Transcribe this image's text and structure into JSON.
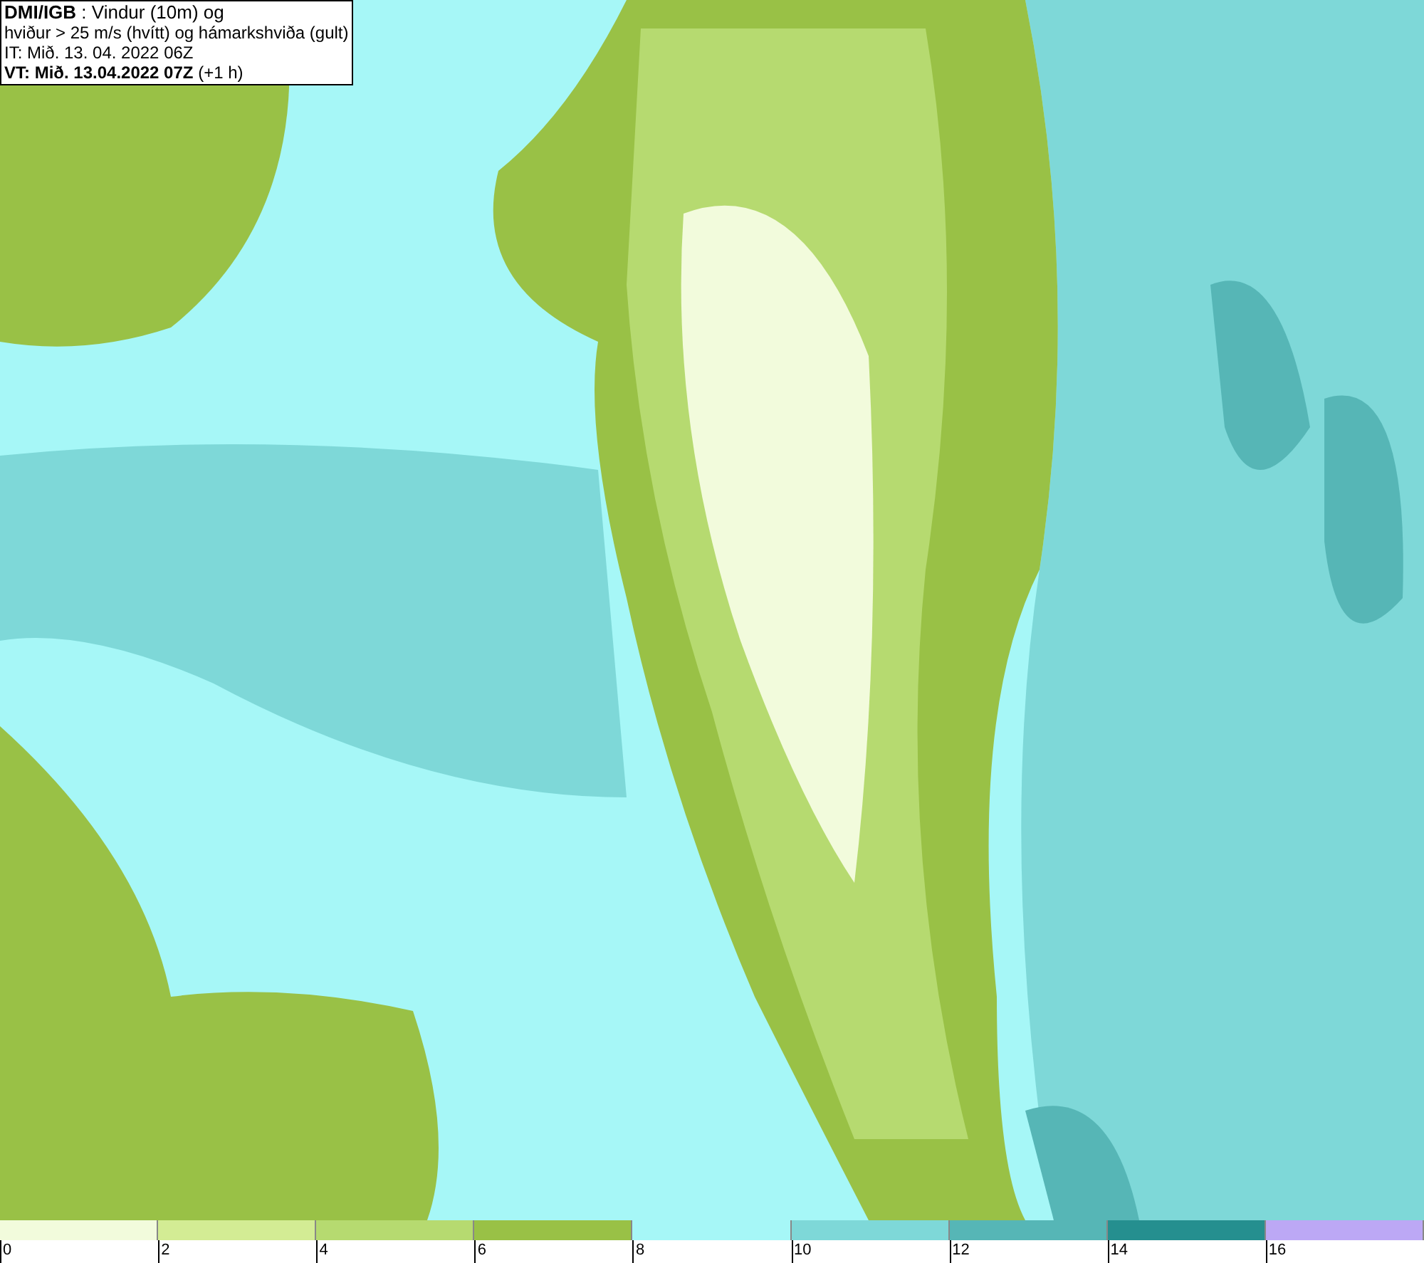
{
  "info_box": {
    "lines": [
      "**DMI/IGB** : Vindur (10m) og",
      "hviður > 25 m/s (hvítt) og hámarkshviða (gult)",
      "IT: Mið. 13. 04. 2022 06Z",
      "**VT: Mið. 13.04.2022 07Z** (+1 h)"
    ]
  },
  "legend": [
    {
      "label": "0",
      "color": "#f2fbdc"
    },
    {
      "label": "2",
      "color": "#d3ec94"
    },
    {
      "label": "4",
      "color": "#b6da70"
    },
    {
      "label": "6",
      "color": "#99c146"
    },
    {
      "label": "8",
      "color": "#a6f7f7"
    },
    {
      "label": "10",
      "color": "#7ed8d8"
    },
    {
      "label": "12",
      "color": "#56b6b6"
    },
    {
      "label": "14",
      "color": "#258f8f"
    },
    {
      "label": "16",
      "color": "#bca8f5"
    }
  ]
}
